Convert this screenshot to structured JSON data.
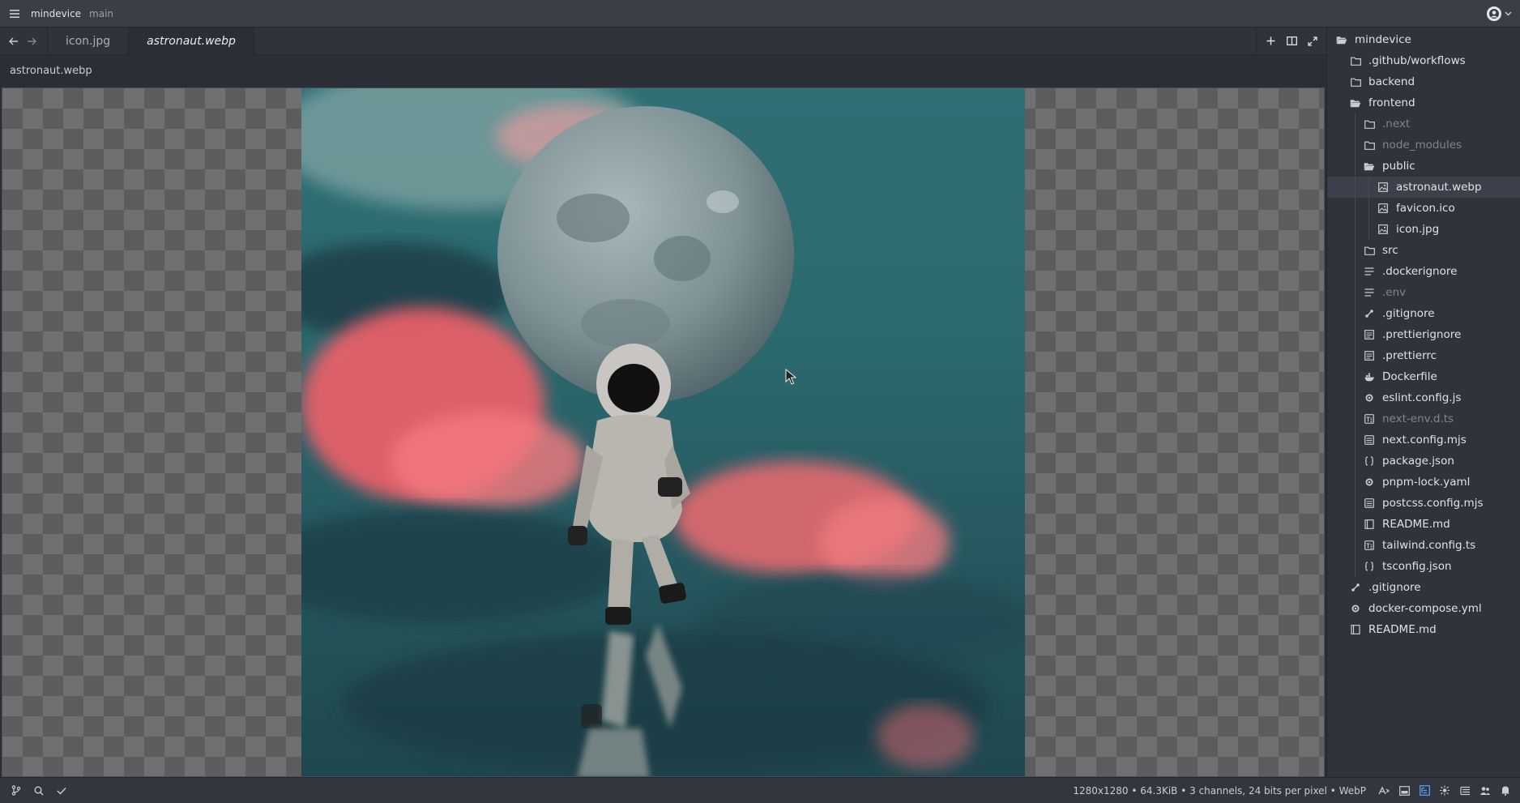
{
  "titlebar": {
    "project": "mindevice",
    "branch": "main"
  },
  "tabs": [
    {
      "label": "icon.jpg",
      "active": false
    },
    {
      "label": "astronaut.webp",
      "active": true
    }
  ],
  "breadcrumb": "astronaut.webp",
  "status": {
    "info": "1280x1280 • 64.3KiB • 3 channels, 24 bits per pixel • WebP"
  },
  "tree": [
    {
      "label": "mindevice",
      "icon": "folder-open-icon",
      "depth": 0,
      "dim": false,
      "selected": false
    },
    {
      "label": ".github/workflows",
      "icon": "folder-icon",
      "depth": 1,
      "dim": false,
      "selected": false
    },
    {
      "label": "backend",
      "icon": "folder-icon",
      "depth": 1,
      "dim": false,
      "selected": false
    },
    {
      "label": "frontend",
      "icon": "folder-open-icon",
      "depth": 1,
      "dim": false,
      "selected": false
    },
    {
      "label": ".next",
      "icon": "folder-icon",
      "depth": 2,
      "dim": true,
      "selected": false
    },
    {
      "label": "node_modules",
      "icon": "folder-icon",
      "depth": 2,
      "dim": true,
      "selected": false
    },
    {
      "label": "public",
      "icon": "folder-open-icon",
      "depth": 2,
      "dim": false,
      "selected": false
    },
    {
      "label": "astronaut.webp",
      "icon": "image-file-icon",
      "depth": 3,
      "dim": false,
      "selected": true
    },
    {
      "label": "favicon.ico",
      "icon": "image-file-icon",
      "depth": 3,
      "dim": false,
      "selected": false
    },
    {
      "label": "icon.jpg",
      "icon": "image-file-icon",
      "depth": 3,
      "dim": false,
      "selected": false
    },
    {
      "label": "src",
      "icon": "folder-icon",
      "depth": 2,
      "dim": false,
      "selected": false
    },
    {
      "label": ".dockerignore",
      "icon": "text-file-icon",
      "depth": 2,
      "dim": false,
      "selected": false
    },
    {
      "label": ".env",
      "icon": "text-file-icon",
      "depth": 2,
      "dim": true,
      "selected": false
    },
    {
      "label": ".gitignore",
      "icon": "git-icon",
      "depth": 2,
      "dim": false,
      "selected": false
    },
    {
      "label": ".prettierignore",
      "icon": "config-file-icon",
      "depth": 2,
      "dim": false,
      "selected": false
    },
    {
      "label": ".prettierrc",
      "icon": "config-file-icon",
      "depth": 2,
      "dim": false,
      "selected": false
    },
    {
      "label": "Dockerfile",
      "icon": "docker-icon",
      "depth": 2,
      "dim": false,
      "selected": false
    },
    {
      "label": "eslint.config.js",
      "icon": "gear-icon",
      "depth": 2,
      "dim": false,
      "selected": false
    },
    {
      "label": "next-env.d.ts",
      "icon": "ts-file-icon",
      "depth": 2,
      "dim": true,
      "selected": false
    },
    {
      "label": "next.config.mjs",
      "icon": "js-file-icon",
      "depth": 2,
      "dim": false,
      "selected": false
    },
    {
      "label": "package.json",
      "icon": "json-file-icon",
      "depth": 2,
      "dim": false,
      "selected": false
    },
    {
      "label": "pnpm-lock.yaml",
      "icon": "gear-icon",
      "depth": 2,
      "dim": false,
      "selected": false
    },
    {
      "label": "postcss.config.mjs",
      "icon": "js-file-icon",
      "depth": 2,
      "dim": false,
      "selected": false
    },
    {
      "label": "README.md",
      "icon": "book-icon",
      "depth": 2,
      "dim": false,
      "selected": false
    },
    {
      "label": "tailwind.config.ts",
      "icon": "ts-file-icon",
      "depth": 2,
      "dim": false,
      "selected": false
    },
    {
      "label": "tsconfig.json",
      "icon": "json-file-icon",
      "depth": 2,
      "dim": false,
      "selected": false
    },
    {
      "label": ".gitignore",
      "icon": "git-icon",
      "depth": 1,
      "dim": false,
      "selected": false
    },
    {
      "label": "docker-compose.yml",
      "icon": "gear-icon",
      "depth": 1,
      "dim": false,
      "selected": false
    },
    {
      "label": "README.md",
      "icon": "book-icon",
      "depth": 1,
      "dim": false,
      "selected": false
    }
  ]
}
